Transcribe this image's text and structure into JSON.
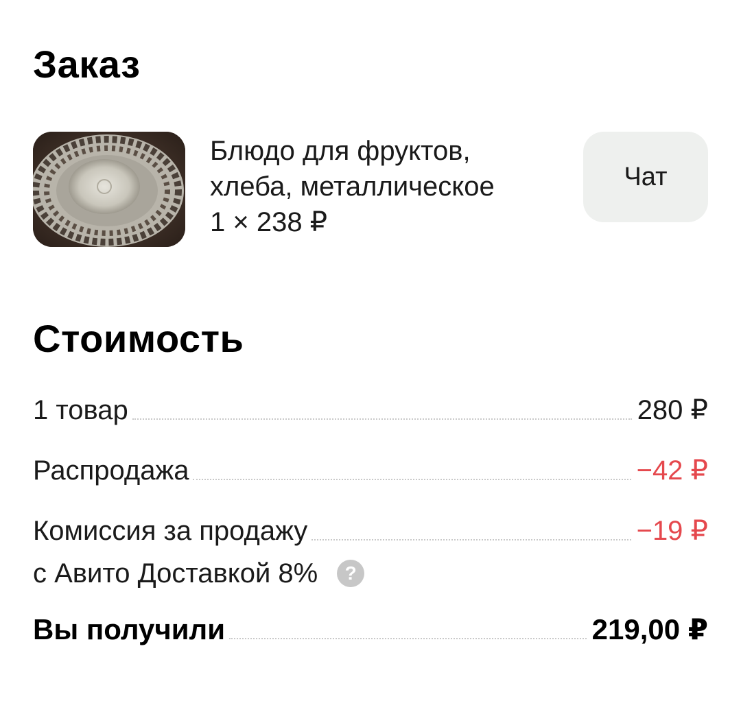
{
  "order": {
    "title": "Заказ",
    "item": {
      "name_line1": "Блюдо для фруктов,",
      "name_line2": "хлеба, металлическое",
      "price_line": "1 × 238 ₽"
    },
    "chat_label": "Чат"
  },
  "cost": {
    "title": "Стоимость",
    "rows": [
      {
        "label": "1 товар",
        "value": "280 ₽"
      },
      {
        "label": "Распродажа",
        "value": "−42 ₽"
      },
      {
        "label": "Комиссия за продажу",
        "label_line2": "с Авито Доставкой 8%",
        "value": "−19 ₽"
      }
    ],
    "total": {
      "label": "Вы получили",
      "value": "219,00 ₽"
    },
    "help_icon_glyph": "?"
  },
  "colors": {
    "negative": "#e5484d",
    "chat_button_bg": "#eef0ee",
    "help_icon_bg": "#c7c7c7"
  },
  "icons": [
    "help-icon"
  ]
}
